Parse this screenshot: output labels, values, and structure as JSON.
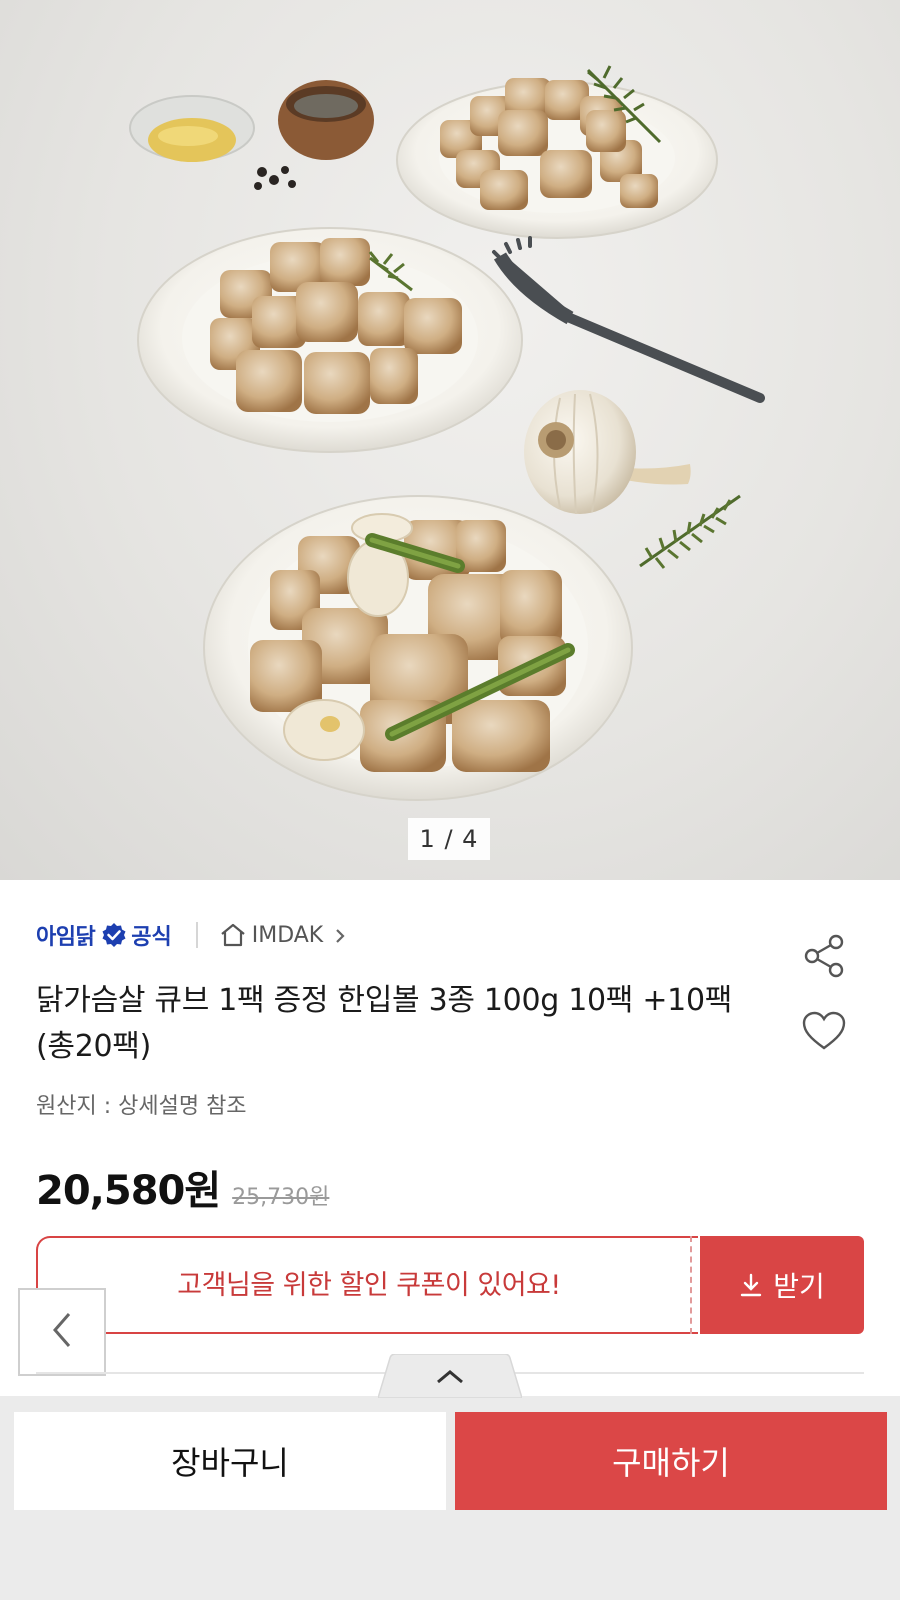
{
  "hero": {
    "pager": "1 / 4"
  },
  "seller": {
    "name": "아임닭",
    "official_label": "공식",
    "store_name": "IMDAK"
  },
  "product": {
    "title": "닭가슴살 큐브 1팩 증정 한입볼 3종 100g 10팩 +10팩 (총20팩)",
    "origin": "원산지 : 상세설명 참조",
    "price": "20,580원",
    "original_price": "25,730원"
  },
  "coupon": {
    "message": "고객님을 위한 할인 쿠폰이 있어요!",
    "button_label": "받기"
  },
  "actions": {
    "cart_label": "장바구니",
    "buy_label": "구매하기"
  },
  "colors": {
    "brand_blue": "#1d3fb0",
    "accent_red": "#d94545"
  },
  "icons": [
    "verified-badge-icon",
    "home-icon",
    "chevron-right-icon",
    "share-icon",
    "heart-icon",
    "download-icon",
    "chevron-left-icon",
    "chevron-up-icon"
  ]
}
